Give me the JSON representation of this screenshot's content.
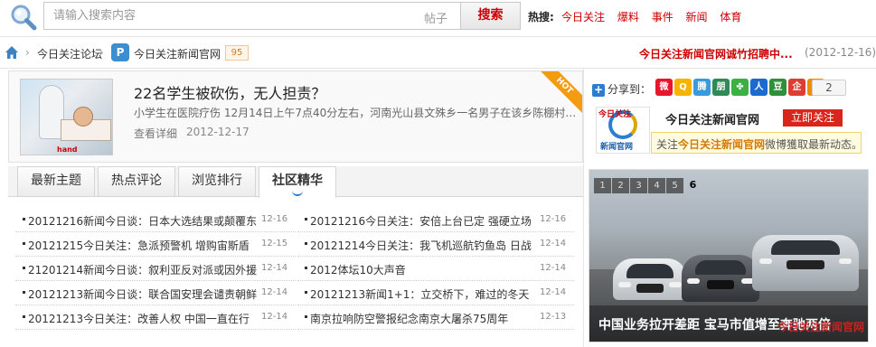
{
  "search": {
    "placeholder": "请输入搜索内容",
    "type_label": "帖子",
    "button_label": "搜索",
    "hot_label": "热搜:",
    "hot_links": [
      "今日关注",
      "爆料",
      "事件",
      "新闻",
      "体育"
    ]
  },
  "breadcrumb": {
    "forum": "今日关注论坛",
    "site_icon": "P",
    "site": "今日关注新闻官网",
    "count": "95",
    "notice": "今日关注新闻官网诚竹招聘中...",
    "notice_date": "(2012-12-16)"
  },
  "feature": {
    "title": "22名学生被砍伤，无人担责？",
    "description": "小学生在医院疗伤 12月14日上午7点40分左右，河南光山县文殊乡一名男子在该乡陈棚村 ...",
    "more_label": "查看详细",
    "date": "2012-12-17",
    "badge": "HOT"
  },
  "share": {
    "label": "分享到：",
    "count": "2",
    "icons": [
      {
        "name": "weibo-icon",
        "glyph": "微",
        "color": "#e6162d"
      },
      {
        "name": "qzone-icon",
        "glyph": "Q",
        "color": "#f5b400"
      },
      {
        "name": "qq-weibo-icon",
        "glyph": "腾",
        "color": "#3a9bdc"
      },
      {
        "name": "pengyou-icon",
        "glyph": "朋",
        "color": "#2e8b57"
      },
      {
        "name": "clover-icon",
        "glyph": "✤",
        "color": "#3cb043"
      },
      {
        "name": "renren-icon",
        "glyph": "人",
        "color": "#1a6ad0"
      },
      {
        "name": "douban-icon",
        "glyph": "豆",
        "color": "#2f8f3a"
      },
      {
        "name": "qq-icon",
        "glyph": "企",
        "color": "#e03c31"
      },
      {
        "name": "sohu-icon",
        "glyph": "搜",
        "color": "#f08c00"
      }
    ]
  },
  "follow": {
    "logo_top": "今日关注",
    "logo_bottom": "新闻官网",
    "name": "今日关注新闻官网",
    "button_label": "立即关注",
    "tip_prefix": "关注",
    "tip_highlight": "今日关注新闻官网",
    "tip_suffix": "微博獲取最新动态。"
  },
  "tabs": [
    "最新主题",
    "热点评论",
    "浏览排行",
    "社区精华"
  ],
  "news": {
    "left": [
      {
        "title": "20121216新闻今日谈：日本大选结果或颠覆东",
        "date": "12-16"
      },
      {
        "title": "20121215今日关注：急派预警机 增购宙斯盾",
        "date": "12-15"
      },
      {
        "title": "21201214新闻今日谈：叙利亚反对派或因外援",
        "date": "12-14"
      },
      {
        "title": "20121213新闻今日谈：联合国安理会谴责朝鲜",
        "date": "12-14"
      },
      {
        "title": "20121213今日关注：改善人权 中国一直在行",
        "date": "12-14"
      }
    ],
    "right": [
      {
        "title": "20121216今日关注：安倍上台已定 强硬立场",
        "date": "12-16"
      },
      {
        "title": "20121214今日关注：我飞机巡航钓鱼岛 日战",
        "date": "12-14"
      },
      {
        "title": "2012体坛10大声音",
        "date": "12-14"
      },
      {
        "title": "20121213新闻1+1：立交桥下，难过的冬天",
        "date": "12-14"
      },
      {
        "title": "南京拉响防空警报纪念南京大屠杀75周年",
        "date": "12-13"
      }
    ]
  },
  "slider": {
    "pages": [
      "1",
      "2",
      "3",
      "4",
      "5",
      "6"
    ],
    "active_page": "6",
    "caption": "中国业务拉开差距 宝马市值增至奔驰两倍",
    "watermark": "今日关注新闻官网"
  }
}
